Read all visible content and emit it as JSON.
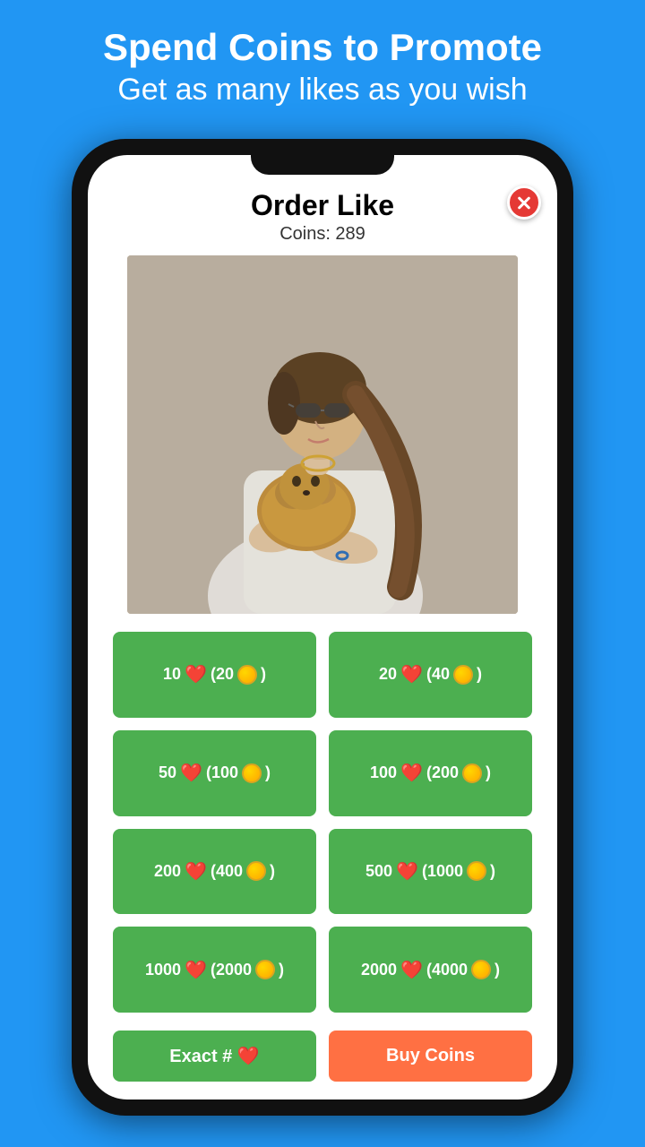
{
  "header": {
    "line1": "Spend Coins to Promote",
    "line2": "Get as many likes as you wish"
  },
  "modal": {
    "title": "Order Like",
    "coins_label": "Coins: 289",
    "close_label": "×"
  },
  "options": [
    {
      "likes": "10",
      "cost": "20",
      "label": "10 ❤️ (20 🪙)"
    },
    {
      "likes": "20",
      "cost": "40",
      "label": "20 ❤️ (40 🪙)"
    },
    {
      "likes": "50",
      "cost": "100",
      "label": "50 ❤️ (100 🪙)"
    },
    {
      "likes": "100",
      "cost": "200",
      "label": "100 ❤️ (200 🪙)"
    },
    {
      "likes": "200",
      "cost": "400",
      "label": "200 ❤️ (400 🪙)"
    },
    {
      "likes": "500",
      "cost": "1000",
      "label": "500 ❤️ (1000 🪙)"
    },
    {
      "likes": "1000",
      "cost": "2000",
      "label": "1000 ❤️ (2000 🪙)"
    },
    {
      "likes": "2000",
      "cost": "4000",
      "label": "2000 ❤️ (4000 🪙)"
    }
  ],
  "bottom_buttons": {
    "exact": "Exact  # ❤️",
    "buy": "Buy  Coins"
  }
}
